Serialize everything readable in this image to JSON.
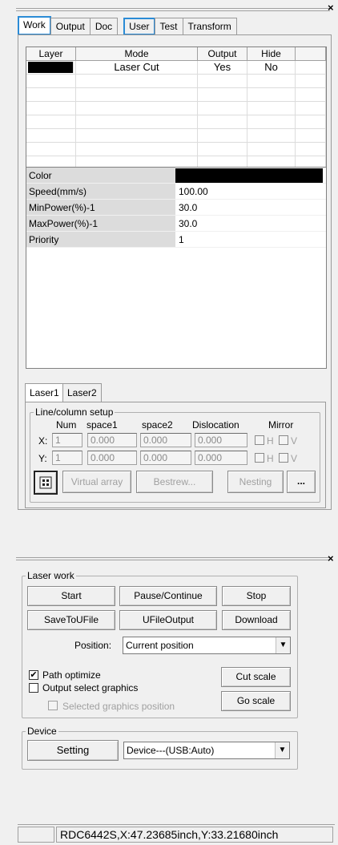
{
  "top_panel": {
    "close_glyph": "×",
    "tabs": [
      {
        "label": "Work",
        "active": true,
        "highlighted": true
      },
      {
        "label": "Output",
        "active": false,
        "highlighted": false
      },
      {
        "label": "Doc",
        "active": false,
        "highlighted": false
      },
      {
        "label": "User",
        "active": false,
        "highlighted": true
      },
      {
        "label": "Test",
        "active": false,
        "highlighted": false
      },
      {
        "label": "Transform",
        "active": false,
        "highlighted": false
      }
    ],
    "layer_table": {
      "headers": [
        "Layer",
        "Mode",
        "Output",
        "Hide"
      ],
      "rows": [
        {
          "layer_color": "#000000",
          "mode": "Laser Cut",
          "output": "Yes",
          "hide": "No"
        }
      ]
    },
    "properties": [
      {
        "key": "Color",
        "value": "",
        "color": "#000000"
      },
      {
        "key": "Speed(mm/s)",
        "value": "100.00"
      },
      {
        "key": "MinPower(%)-1",
        "value": "30.0"
      },
      {
        "key": "MaxPower(%)-1",
        "value": "30.0"
      },
      {
        "key": "Priority",
        "value": "1"
      }
    ],
    "laser_tabs": [
      "Laser1",
      "Laser2"
    ],
    "line_column": {
      "title": "Line/column setup",
      "headers": [
        "Num",
        "space1",
        "space2",
        "Dislocation",
        "Mirror"
      ],
      "rows": [
        {
          "axis": "X:",
          "num": "1",
          "space1": "0.000",
          "space2": "0.000",
          "dislocation": "0.000",
          "mirror_h": "H",
          "mirror_v": "V"
        },
        {
          "axis": "Y:",
          "num": "1",
          "space1": "0.000",
          "space2": "0.000",
          "dislocation": "0.000",
          "mirror_h": "H",
          "mirror_v": "V"
        }
      ],
      "buttons": {
        "virtual_array": "Virtual array",
        "bestrew": "Bestrew...",
        "nesting": "Nesting",
        "more": "..."
      }
    }
  },
  "bottom_panel": {
    "close_glyph": "×",
    "laser_work": {
      "title": "Laser work",
      "buttons": {
        "start": "Start",
        "pause": "Pause/Continue",
        "stop": "Stop",
        "save_to_ufile": "SaveToUFile",
        "ufile_output": "UFileOutput",
        "download": "Download",
        "cut_scale": "Cut scale",
        "go_scale": "Go scale"
      },
      "position_label": "Position:",
      "position_value": "Current position",
      "path_optimize": {
        "label": "Path optimize",
        "checked": true,
        "mark": "✔"
      },
      "output_select": {
        "label": "Output select graphics",
        "checked": false
      },
      "selected_position": {
        "label": "Selected graphics position",
        "checked": false,
        "disabled": true
      }
    },
    "device": {
      "title": "Device",
      "setting_button": "Setting",
      "device_value": "Device---(USB:Auto)"
    }
  },
  "status_bar": {
    "text": "RDC6442S,X:47.23685inch,Y:33.21680inch"
  },
  "colors": {
    "tab_highlight": "#2b8bd6",
    "panel_bg": "#f0f0f0",
    "grid_key_bg": "#dcdcdc"
  }
}
